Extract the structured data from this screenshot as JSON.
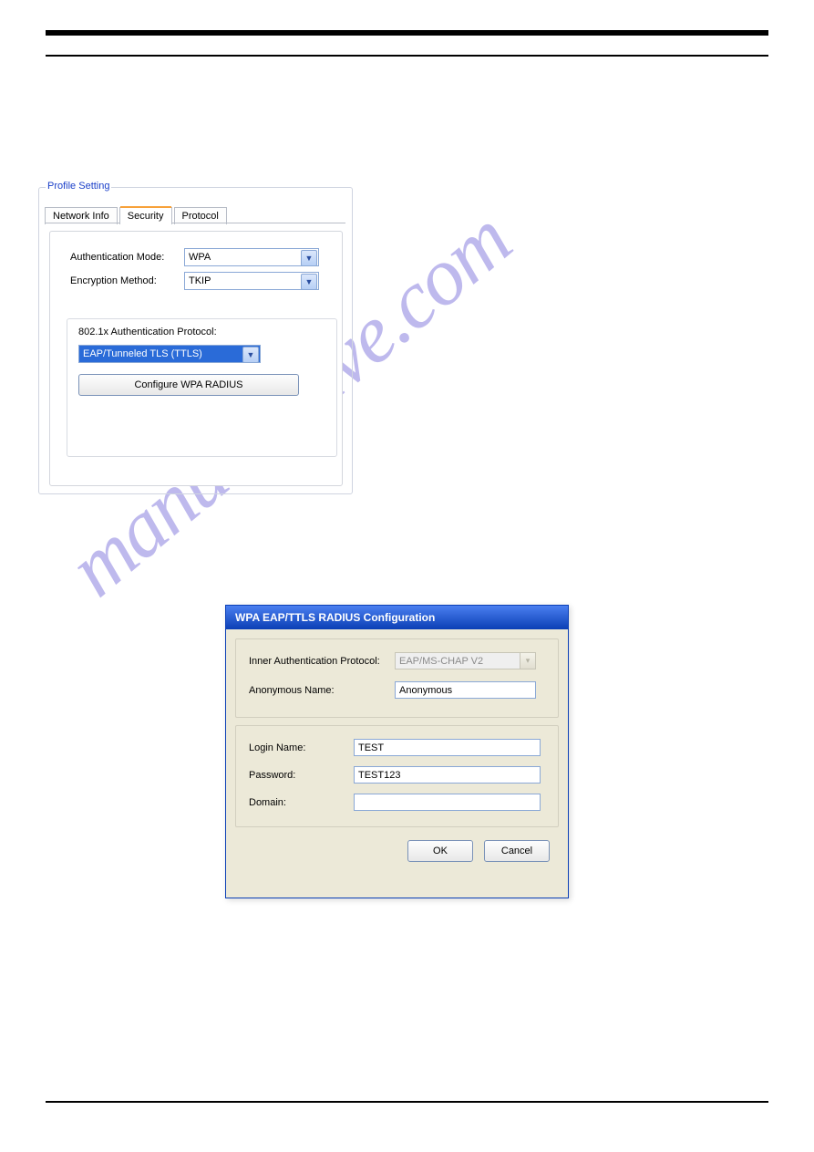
{
  "watermark": "manualshive.com",
  "profile": {
    "legend": "Profile Setting",
    "tabs": [
      {
        "label": "Network Info"
      },
      {
        "label": "Security"
      },
      {
        "label": "Protocol"
      }
    ],
    "auth_mode_label": "Authentication Mode:",
    "auth_mode_value": "WPA",
    "enc_method_label": "Encryption Method:",
    "enc_method_value": "TKIP",
    "group_label": "802.1x Authentication Protocol:",
    "protocol_value": "EAP/Tunneled TLS (TTLS)",
    "configure_button": "Configure WPA RADIUS"
  },
  "dialog": {
    "title": "WPA EAP/TTLS RADIUS Configuration",
    "inner_auth_label": "Inner Authentication Protocol:",
    "inner_auth_value": "EAP/MS-CHAP V2",
    "anon_label": "Anonymous Name:",
    "anon_value": "Anonymous",
    "login_label": "Login Name:",
    "login_value": "TEST",
    "password_label": "Password:",
    "password_value": "TEST123",
    "domain_label": "Domain:",
    "domain_value": "",
    "ok": "OK",
    "cancel": "Cancel"
  }
}
